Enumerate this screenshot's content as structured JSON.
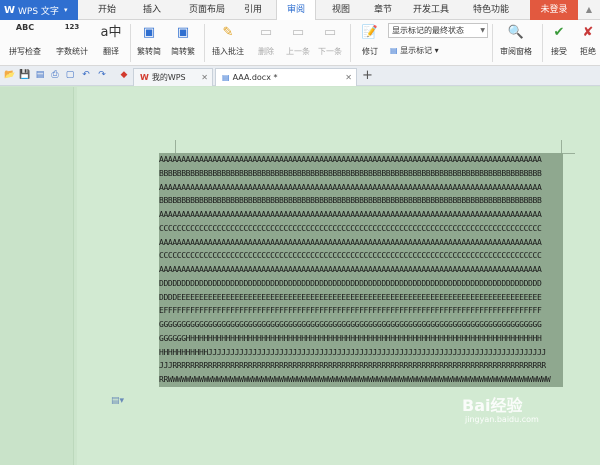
{
  "app": {
    "logo": "W",
    "title": "WPS 文字"
  },
  "menu": {
    "items": [
      "开始",
      "插入",
      "页面布局",
      "引用",
      "审阅",
      "视图",
      "章节",
      "开发工具",
      "特色功能"
    ],
    "login": "未登录"
  },
  "ribbon": {
    "spell_check": "拼写检查",
    "word_count": "字数统计",
    "translate": "翻译",
    "to_simplified": "繁转简",
    "to_traditional": "简转繁",
    "insert_comment": "插入批注",
    "delete": "删除",
    "previous": "上一条",
    "next": "下一条",
    "track_changes": "修订",
    "markup_view_select": "显示标记的最终状态",
    "show_markup": "显示标记",
    "review_pane": "审阅窗格",
    "accept": "接受",
    "reject": "拒绝",
    "abc_icon_text": "ABC",
    "count_icon_text": "123\nABC"
  },
  "tabs": {
    "home": "我的WPS",
    "doc": "AAA.docx *",
    "new_tab": "+"
  },
  "document": {
    "lines": [
      "AAAAAAAAAAAAAAAAAAAAAAAAAAAAAAAAAAAAAAAAAAAAAAAAAAAAAAAAAAAAAAAAAAAAAAAAAAAAAAAAAAAAAA",
      "BBBBBBBBBBBBBBBBBBBBBBBBBBBBBBBBBBBBBBBBBBBBBBBBBBBBBBBBBBBBBBBBBBBBBBBBBBBBBBBBBBBBBB",
      "AAAAAAAAAAAAAAAAAAAAAAAAAAAAAAAAAAAAAAAAAAAAAAAAAAAAAAAAAAAAAAAAAAAAAAAAAAAAAAAAAAAAAA",
      "BBBBBBBBBBBBBBBBBBBBBBBBBBBBBBBBBBBBBBBBBBBBBBBBBBBBBBBBBBBBBBBBBBBBBBBBBBBBBBBBBBBBBB",
      "AAAAAAAAAAAAAAAAAAAAAAAAAAAAAAAAAAAAAAAAAAAAAAAAAAAAAAAAAAAAAAAAAAAAAAAAAAAAAAAAAAAAAA",
      "CCCCCCCCCCCCCCCCCCCCCCCCCCCCCCCCCCCCCCCCCCCCCCCCCCCCCCCCCCCCCCCCCCCCCCCCCCCCCCCCCCCCCC",
      "AAAAAAAAAAAAAAAAAAAAAAAAAAAAAAAAAAAAAAAAAAAAAAAAAAAAAAAAAAAAAAAAAAAAAAAAAAAAAAAAAAAAAA",
      "CCCCCCCCCCCCCCCCCCCCCCCCCCCCCCCCCCCCCCCCCCCCCCCCCCCCCCCCCCCCCCCCCCCCCCCCCCCCCCCCCCCCCC",
      "AAAAAAAAAAAAAAAAAAAAAAAAAAAAAAAAAAAAAAAAAAAAAAAAAAAAAAAAAAAAAAAAAAAAAAAAAAAAAAAAAAAAAA",
      "DDDDDDDDDDDDDDDDDDDDDDDDDDDDDDDDDDDDDDDDDDDDDDDDDDDDDDDDDDDDDDDDDDDDDDDDDDDDDDDDDDDDDD",
      "DDDDEEEEEEEEEEEEEEEEEEEEEEEEEEEEEEEEEEEEEEEEEEEEEEEEEEEEEEEEEEEEEEEEEEEEEEEEEEEEEEEEEE",
      "EFFFFFFFFFFFFFFFFFFFFFFFFFFFFFFFFFFFFFFFFFFFFFFFFFFFFFFFFFFFFFFFFFFFFFFFFFFFFFFFFFFFFF",
      "GGGGGGGGGGGGGGGGGGGGGGGGGGGGGGGGGGGGGGGGGGGGGGGGGGGGGGGGGGGGGGGGGGGGGGGGGGGGGGGGGGGGGG",
      "GGGGGGHHHHHHHHHHHHHHHHHHHHHHHHHHHHHHHHHHHHHHHHHHHHHHHHHHHHHHHHHHHHHHHHHHHHHHHHHHHHHHHH",
      "HHHHHHHHHHHJJJJJJJJJJJJJJJJJJJJJJJJJJJJJJJJJJJJJJJJJJJJJJJJJJJJJJJJJJJJJJJJJJJJJJJJJJJJ",
      "JJJRRRRRRRRRRRRRRRRRRRRRRRRRRRRRRRRRRRRRRRRRRRRRRRRRRRRRRRRRRRRRRRRRRRRRRRRRRRRRRRRRRRR",
      "RRWWWWWWWWWWWWWWWWWWWWWWWWWWWWWWWWWWWWWWWWWWWWWWWWWWWWWWWWWWWWWWWWWWWWWWWWWWWWWWWWWWWWWW"
    ]
  },
  "watermark": {
    "text": "Bai经验",
    "url": "jingyan.baidu.com"
  },
  "colors": {
    "accent": "#2f6fd0",
    "login": "#e2593f",
    "doc_bg": "#d2ead2",
    "selection": "#8fa88f"
  }
}
